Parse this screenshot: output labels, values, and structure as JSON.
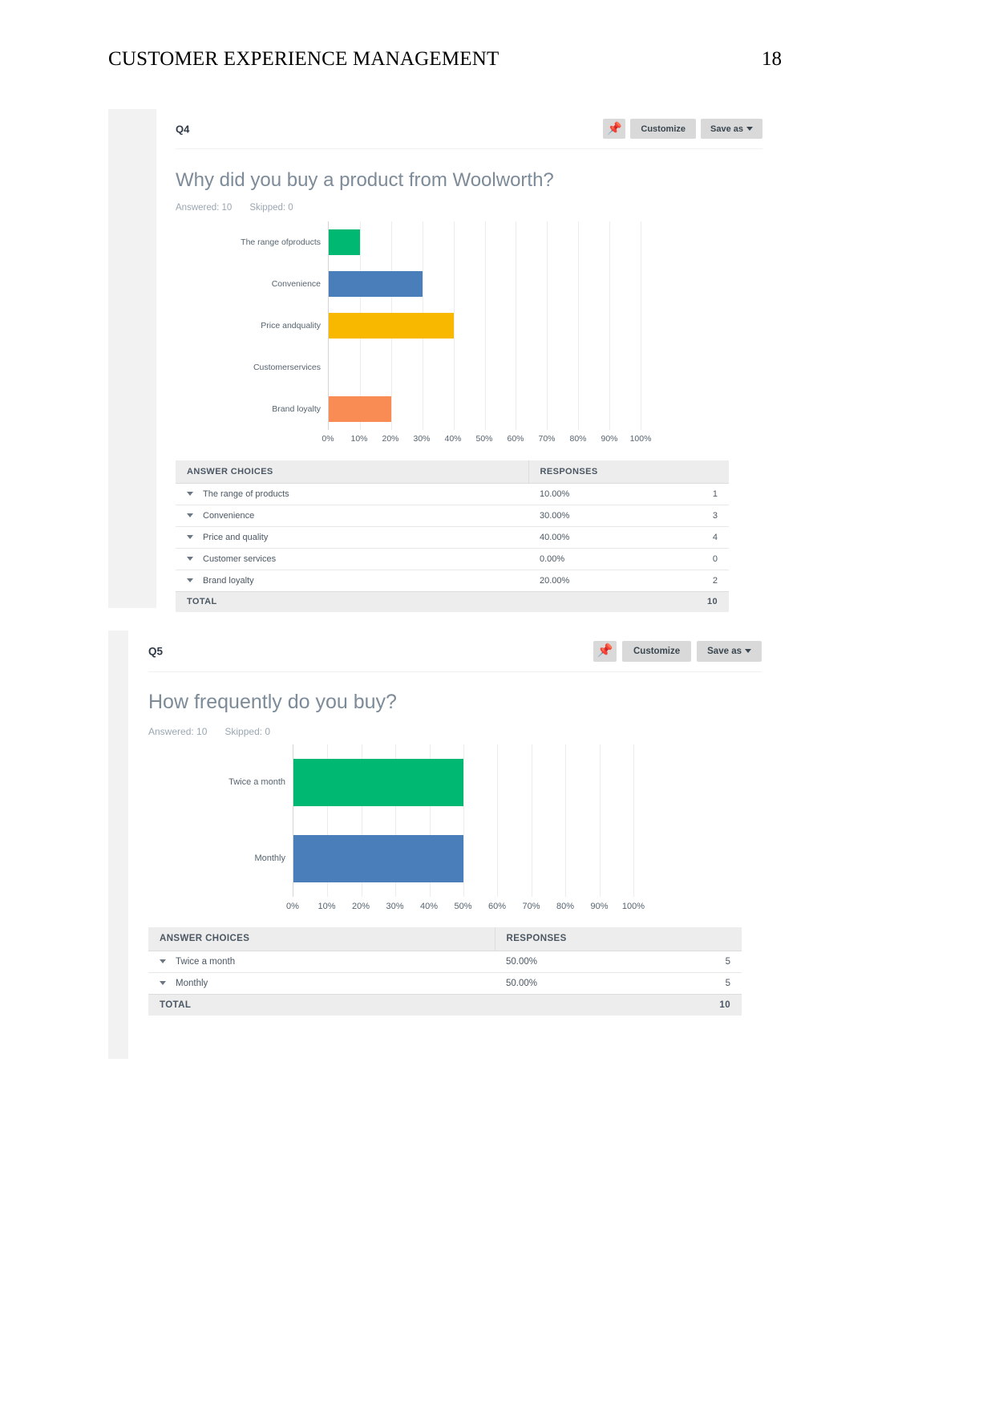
{
  "document": {
    "header_title": "CUSTOMER EXPERIENCE MANAGEMENT",
    "page_number": "18"
  },
  "colors": {
    "green": "#00b871",
    "blue": "#4a7ebb",
    "yellow": "#f9b800",
    "orange": "#f98b55",
    "card_bg": "#f2f2f2",
    "panel_bg": "#ffffff",
    "table_header_bg": "#ededed"
  },
  "cards": [
    {
      "question_number": "Q4",
      "toolbar": {
        "pin_icon": "pushpin-icon",
        "customize_label": "Customize",
        "save_as_label": "Save as",
        "save_as_caret": "chevron-down-icon"
      },
      "title": "Why did you buy a product from Woolworth?",
      "meta": {
        "answered_label": "Answered: 10",
        "skipped_label": "Skipped: 0"
      },
      "chart_data": {
        "type": "bar",
        "orientation": "horizontal",
        "title": "Why did you buy a product from Woolworth?",
        "xlabel": "",
        "ylabel": "",
        "xlim": [
          0,
          100
        ],
        "grid": true,
        "legend": "none",
        "tick_labels": [
          "0%",
          "10%",
          "20%",
          "30%",
          "40%",
          "50%",
          "60%",
          "70%",
          "80%",
          "90%",
          "100%"
        ],
        "tick_values": [
          0,
          10,
          20,
          30,
          40,
          50,
          60,
          70,
          80,
          90,
          100
        ],
        "categories": [
          "The range of products",
          "Convenience",
          "Price and quality",
          "Customer services",
          "Brand loyalty"
        ],
        "category_lines": [
          [
            "The range of",
            "products"
          ],
          [
            "Convenience"
          ],
          [
            "Price and",
            "quality"
          ],
          [
            "Customer",
            "services"
          ],
          [
            "Brand loyalty"
          ]
        ],
        "values": [
          10,
          30,
          40,
          0,
          20
        ],
        "bar_colors": [
          "#00b871",
          "#4a7ebb",
          "#f9b800",
          "#f98b55",
          "#f98b55"
        ]
      },
      "table": {
        "columns": [
          "ANSWER CHOICES",
          "RESPONSES",
          ""
        ],
        "rows": [
          {
            "choice": "The range of products",
            "percent": "10.00%",
            "count": "1"
          },
          {
            "choice": "Convenience",
            "percent": "30.00%",
            "count": "3"
          },
          {
            "choice": "Price and quality",
            "percent": "40.00%",
            "count": "4"
          },
          {
            "choice": "Customer services",
            "percent": "0.00%",
            "count": "0"
          },
          {
            "choice": "Brand loyalty",
            "percent": "20.00%",
            "count": "2"
          }
        ],
        "total_label": "TOTAL",
        "total_count": "10"
      }
    },
    {
      "question_number": "Q5",
      "toolbar": {
        "pin_icon": "pushpin-icon",
        "customize_label": "Customize",
        "save_as_label": "Save as",
        "save_as_caret": "chevron-down-icon"
      },
      "title": "How frequently do you buy?",
      "meta": {
        "answered_label": "Answered: 10",
        "skipped_label": "Skipped: 0"
      },
      "chart_data": {
        "type": "bar",
        "orientation": "horizontal",
        "title": "How frequently do you buy?",
        "xlabel": "",
        "ylabel": "",
        "xlim": [
          0,
          100
        ],
        "grid": true,
        "legend": "none",
        "tick_labels": [
          "0%",
          "10%",
          "20%",
          "30%",
          "40%",
          "50%",
          "60%",
          "70%",
          "80%",
          "90%",
          "100%"
        ],
        "tick_values": [
          0,
          10,
          20,
          30,
          40,
          50,
          60,
          70,
          80,
          90,
          100
        ],
        "categories": [
          "Twice a month",
          "Monthly"
        ],
        "category_lines": [
          [
            "Twice a month"
          ],
          [
            "Monthly"
          ]
        ],
        "values": [
          50,
          50
        ],
        "bar_colors": [
          "#00b871",
          "#4a7ebb"
        ]
      },
      "table": {
        "columns": [
          "ANSWER CHOICES",
          "RESPONSES",
          ""
        ],
        "rows": [
          {
            "choice": "Twice a month",
            "percent": "50.00%",
            "count": "5"
          },
          {
            "choice": "Monthly",
            "percent": "50.00%",
            "count": "5"
          }
        ],
        "total_label": "TOTAL",
        "total_count": "10"
      }
    }
  ]
}
